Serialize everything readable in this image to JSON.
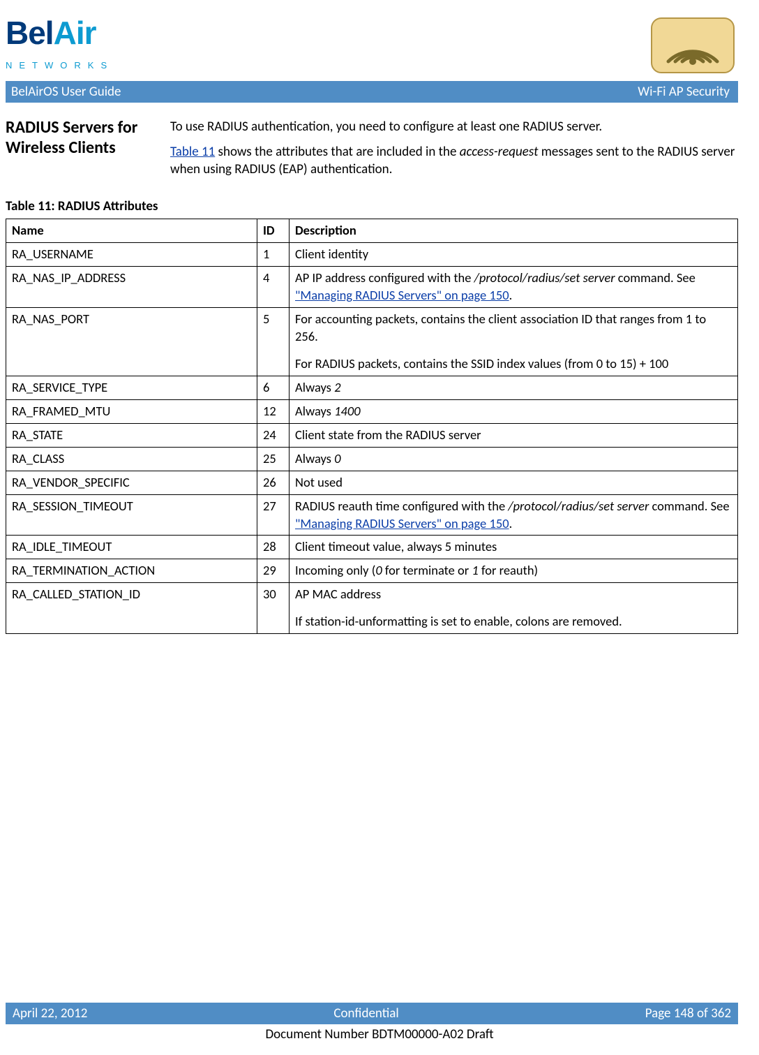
{
  "header": {
    "guide_title": "BelAirOS User Guide",
    "page_topic": "Wi-Fi AP Security",
    "logo_networks": "NETWORKS"
  },
  "section": {
    "title": "RADIUS Servers for Wireless Clients",
    "p1": "To use RADIUS authentication, you need to configure at least one RADIUS server.",
    "p2_pre": "Table 11",
    "p2_mid": " shows the attributes that are included in the ",
    "p2_italic": "access-request",
    "p2_post": " messages sent to the RADIUS server when using RADIUS (EAP) authentication."
  },
  "table": {
    "caption": "Table 11: RADIUS Attributes",
    "headers": {
      "name": "Name",
      "id": "ID",
      "desc": "Description"
    },
    "rows": [
      {
        "name": "RA_USERNAME",
        "id": "1",
        "desc": [
          {
            "type": "text",
            "v": "Client identity"
          }
        ]
      },
      {
        "name": "RA_NAS_IP_ADDRESS",
        "id": "4",
        "desc": [
          {
            "type": "text",
            "v": "AP IP address configured with the "
          },
          {
            "type": "italic",
            "v": "/protocol/radius/set server"
          },
          {
            "type": "text",
            "v": " command. See "
          },
          {
            "type": "link",
            "v": "\"Managing RADIUS Servers\" on page 150"
          },
          {
            "type": "text",
            "v": "."
          }
        ]
      },
      {
        "name": "RA_NAS_PORT",
        "id": "5",
        "desc": [
          {
            "type": "block",
            "v": "For accounting packets, contains the client association ID that ranges from 1 to 256."
          },
          {
            "type": "block",
            "v": "For RADIUS packets, contains the SSID index values (from 0 to 15) + 100"
          }
        ]
      },
      {
        "name": "RA_SERVICE_TYPE",
        "id": "6",
        "desc": [
          {
            "type": "text",
            "v": "Always "
          },
          {
            "type": "italic",
            "v": "2"
          }
        ]
      },
      {
        "name": "RA_FRAMED_MTU",
        "id": "12",
        "desc": [
          {
            "type": "text",
            "v": "Always "
          },
          {
            "type": "italic",
            "v": "1400"
          }
        ]
      },
      {
        "name": "RA_STATE",
        "id": "24",
        "desc": [
          {
            "type": "text",
            "v": "Client state from the RADIUS server"
          }
        ]
      },
      {
        "name": "RA_CLASS",
        "id": "25",
        "desc": [
          {
            "type": "text",
            "v": "Always "
          },
          {
            "type": "italic",
            "v": "0"
          }
        ]
      },
      {
        "name": "RA_VENDOR_SPECIFIC",
        "id": "26",
        "desc": [
          {
            "type": "text",
            "v": "Not used"
          }
        ]
      },
      {
        "name": "RA_SESSION_TIMEOUT",
        "id": "27",
        "desc": [
          {
            "type": "text",
            "v": "RADIUS reauth time configured with the "
          },
          {
            "type": "italic",
            "v": "/protocol/radius/set server"
          },
          {
            "type": "text",
            "v": " command. See "
          },
          {
            "type": "link",
            "v": "\"Managing RADIUS Servers\" on page 150"
          },
          {
            "type": "text",
            "v": "."
          }
        ]
      },
      {
        "name": "RA_IDLE_TIMEOUT",
        "id": "28",
        "desc": [
          {
            "type": "text",
            "v": "Client timeout value, always 5 minutes"
          }
        ]
      },
      {
        "name": "RA_TERMINATION_ACTION",
        "id": "29",
        "desc": [
          {
            "type": "text",
            "v": "Incoming only ("
          },
          {
            "type": "italic",
            "v": "0"
          },
          {
            "type": "text",
            "v": " for terminate or "
          },
          {
            "type": "italic",
            "v": "1"
          },
          {
            "type": "text",
            "v": " for reauth)"
          }
        ]
      },
      {
        "name": "RA_CALLED_STATION_ID",
        "id": "30",
        "desc": [
          {
            "type": "block",
            "v": "AP MAC address"
          },
          {
            "type": "block",
            "v": "If station-id-unformatting is set to enable, colons are removed."
          }
        ]
      }
    ]
  },
  "footer": {
    "date": "April 22, 2012",
    "conf": "Confidential",
    "page": "Page 148 of 362",
    "docnum": "Document Number BDTM00000-A02 Draft"
  }
}
